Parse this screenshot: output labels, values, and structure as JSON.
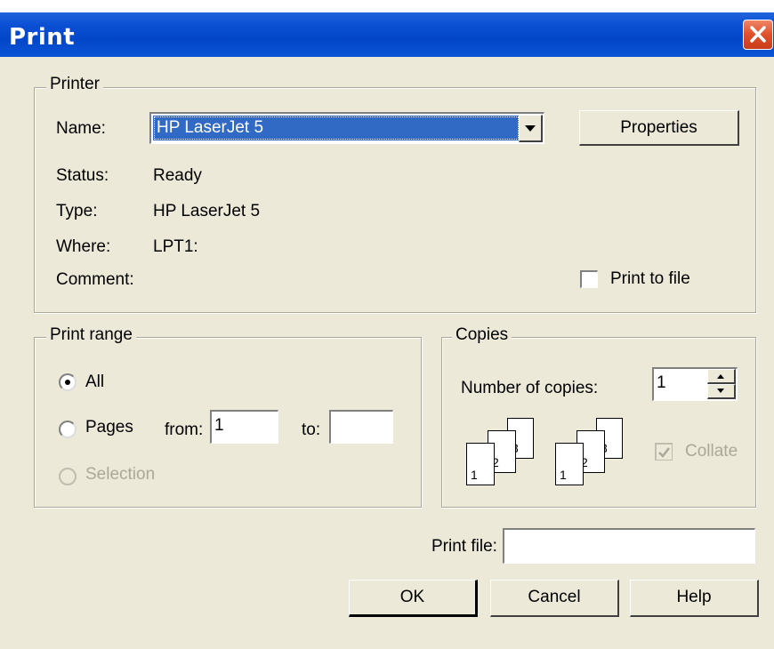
{
  "window": {
    "title": "Print",
    "close_icon": "close-icon"
  },
  "printer_group": {
    "legend": "Printer",
    "name_label": "Name:",
    "name_value": "HP LaserJet 5",
    "properties_label": "Properties",
    "status_label": "Status:",
    "status_value": "Ready",
    "type_label": "Type:",
    "type_value": "HP LaserJet 5",
    "where_label": "Where:",
    "where_value": "LPT1:",
    "comment_label": "Comment:",
    "print_to_file_label": "Print to file"
  },
  "print_range": {
    "legend": "Print range",
    "all_label": "All",
    "pages_label": "Pages",
    "from_label": "from:",
    "from_value": "1",
    "to_label": "to:",
    "to_value": "",
    "selection_label": "Selection",
    "selected": "all"
  },
  "copies": {
    "legend": "Copies",
    "number_label": "Number of copies:",
    "number_value": "1",
    "collate_label": "Collate",
    "collate_checked": true,
    "page_numbers": [
      "1",
      "2",
      "3"
    ]
  },
  "print_file": {
    "label": "Print file:",
    "value": ""
  },
  "buttons": {
    "ok": "OK",
    "cancel": "Cancel",
    "help": "Help"
  },
  "colors": {
    "titlebar": "#0a4fd3",
    "dialog_bg": "#ece9d8",
    "selection": "#316ac5",
    "close": "#e0502a"
  }
}
